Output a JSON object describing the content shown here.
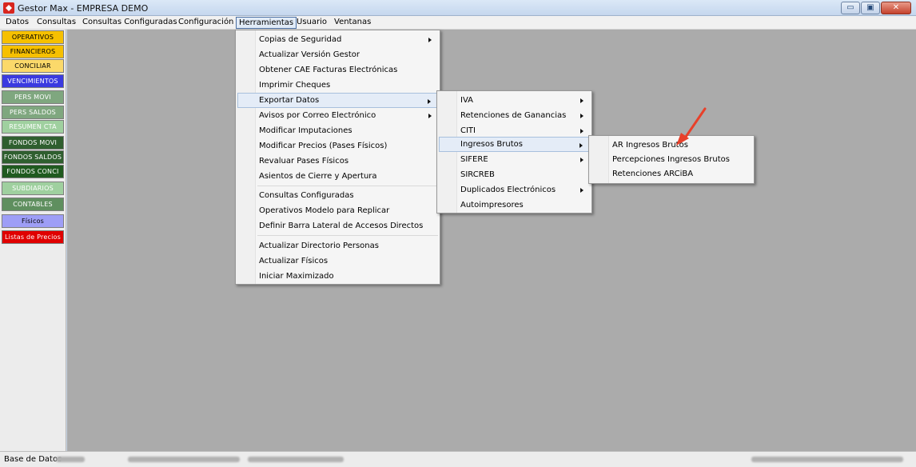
{
  "window": {
    "title": "Gestor Max - EMPRESA DEMO",
    "minimize": "▭",
    "maximize": "▣",
    "close": "✕"
  },
  "menubar": [
    "Datos",
    "Consultas",
    "Consultas Configuradas",
    "Configuración",
    "Herramientas",
    "Usuario",
    "Ventanas"
  ],
  "sidebar": [
    {
      "label": "OPERATIVOS",
      "bg": "#f6c000",
      "fg": "#000000"
    },
    {
      "label": "FINANCIEROS",
      "bg": "#f6c000",
      "fg": "#000000"
    },
    {
      "label": "CONCILIAR",
      "bg": "#fbd96a",
      "fg": "#000000"
    },
    {
      "label": "VENCIMIENTOS",
      "bg": "#3a3ae0",
      "fg": "#ffffff"
    },
    {
      "label": "PERS MOVI",
      "bg": "#7fa77f",
      "fg": "#ffffff"
    },
    {
      "label": "PERS SALDOS",
      "bg": "#7fa77f",
      "fg": "#ffffff"
    },
    {
      "label": "RESUMEN CTA",
      "bg": "#9fd09f",
      "fg": "#ffffff"
    },
    {
      "label": "FONDOS MOVI",
      "bg": "#2f5f2f",
      "fg": "#ffffff"
    },
    {
      "label": "FONDOS SALDOS",
      "bg": "#2f5f2f",
      "fg": "#ffffff"
    },
    {
      "label": "FONDOS CONCI",
      "bg": "#1f5a1f",
      "fg": "#ffffff"
    },
    {
      "label": "SUBDIARIOS",
      "bg": "#9fd09f",
      "fg": "#ffffff"
    },
    {
      "label": "CONTABLES",
      "bg": "#5f8f5f",
      "fg": "#ffffff"
    },
    {
      "label": "Físicos",
      "bg": "#9e9ef6",
      "fg": "#000000"
    },
    {
      "label": "Listas de Precios",
      "bg": "#e00000",
      "fg": "#ffffff"
    }
  ],
  "herramientas_menu": [
    {
      "label": "Copias de Seguridad",
      "submenu": true
    },
    {
      "label": "Actualizar Versión Gestor",
      "submenu": false
    },
    {
      "label": "Obtener CAE Facturas Electrónicas",
      "submenu": false
    },
    {
      "label": "Imprimir Cheques",
      "submenu": false
    },
    {
      "label": "Exportar Datos",
      "submenu": true
    },
    {
      "label": "Avisos por Correo Electrónico",
      "submenu": true
    },
    {
      "label": "Modificar Imputaciones",
      "submenu": false
    },
    {
      "label": "Modificar Precios (Pases Físicos)",
      "submenu": false
    },
    {
      "label": "Revaluar Pases Físicos",
      "submenu": false
    },
    {
      "label": "Asientos de Cierre y Apertura",
      "submenu": false
    },
    {
      "label": "Consultas Configuradas",
      "submenu": false
    },
    {
      "label": "Operativos Modelo para Replicar",
      "submenu": false
    },
    {
      "label": "Definir Barra Lateral de Accesos Directos",
      "submenu": false
    },
    {
      "label": "Actualizar Directorio Personas",
      "submenu": false
    },
    {
      "label": "Actualizar Físicos",
      "submenu": false
    },
    {
      "label": "Iniciar Maximizado",
      "submenu": false
    }
  ],
  "exportar_menu": [
    {
      "label": "IVA",
      "submenu": true
    },
    {
      "label": "Retenciones de Ganancias",
      "submenu": true
    },
    {
      "label": "CITI",
      "submenu": true
    },
    {
      "label": "Ingresos Brutos",
      "submenu": true
    },
    {
      "label": "SIFERE",
      "submenu": true
    },
    {
      "label": "SIRCREB",
      "submenu": false
    },
    {
      "label": "Duplicados Electrónicos",
      "submenu": true
    },
    {
      "label": "Autoimpresores",
      "submenu": false
    }
  ],
  "ingresos_menu": [
    {
      "label": "AR Ingresos Brutos"
    },
    {
      "label": "Percepciones Ingresos Brutos"
    },
    {
      "label": "Retenciones ARCiBA"
    }
  ],
  "status": {
    "label": "Base de Datos"
  },
  "colors": {
    "accent": "#4a6fa3",
    "annotation_arrow": "#e8402a"
  }
}
